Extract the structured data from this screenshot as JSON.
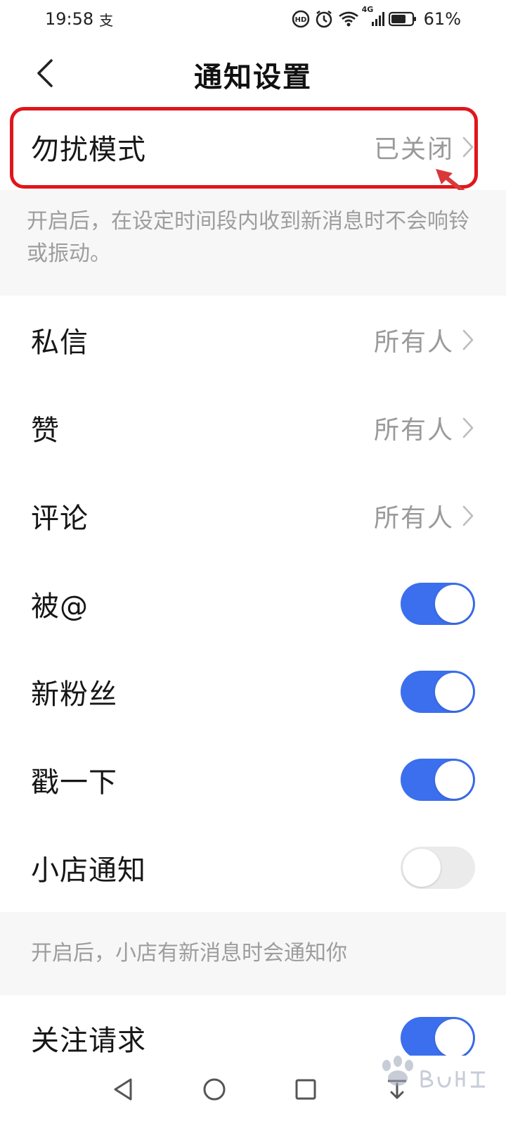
{
  "status_bar": {
    "time": "19:58",
    "app_indicator": "支",
    "network_label": "4G",
    "battery_percent": "61%",
    "icons": [
      "hd-call-icon",
      "alarm-icon",
      "wifi-icon",
      "cellular-signal-icon",
      "battery-icon"
    ]
  },
  "header": {
    "title": "通知设置",
    "back_icon": "chevron-left-icon"
  },
  "dnd": {
    "label": "勿扰模式",
    "value": "已关闭",
    "description": "开启后，在设定时间段内收到新消息时不会响铃或振动。",
    "highlight_color": "#e0161c"
  },
  "settings": {
    "private_message": {
      "label": "私信",
      "value": "所有人"
    },
    "likes": {
      "label": "赞",
      "value": "所有人"
    },
    "comments": {
      "label": "评论",
      "value": "所有人"
    },
    "mentions": {
      "label": "被@",
      "enabled": true
    },
    "new_followers": {
      "label": "新粉丝",
      "enabled": true
    },
    "poke": {
      "label": "戳一下",
      "enabled": true
    },
    "shop_notification": {
      "label": "小店通知",
      "enabled": false,
      "description": "开启后，小店有新消息时会通知你"
    },
    "follow_request": {
      "label": "关注请求",
      "enabled": true
    }
  },
  "colors": {
    "toggle_on": "#3b6fee",
    "toggle_off": "#ebebeb",
    "secondary_text": "#9a9a9a",
    "section_background": "#f7f7f7"
  },
  "nav_bar": {
    "icons": [
      "back-triangle-icon",
      "home-circle-icon",
      "recents-square-icon",
      "download-icon"
    ]
  }
}
